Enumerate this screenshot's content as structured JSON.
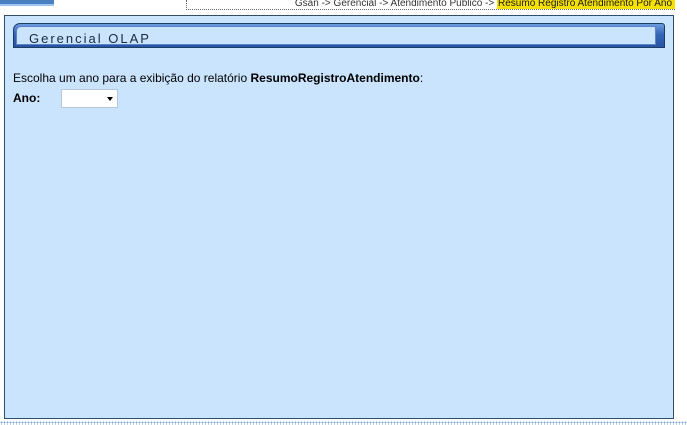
{
  "breadcrumb": {
    "items": [
      "Gsan",
      "Gerencial",
      "Atendimento Publico"
    ],
    "separator": " -> ",
    "current": "Resumo Registro Atendimento Por Ano"
  },
  "panel": {
    "title": "Gerencial OLAP"
  },
  "form": {
    "instruction_prefix": "Escolha um ano para a exibição do relatório ",
    "report_name": "ResumoRegistroAtendimento",
    "instruction_suffix": ":",
    "year_label": "Ano:",
    "year_value": ""
  },
  "colors": {
    "panel_background": "#cae4fd",
    "header_blue": "#3565b5",
    "breadcrumb_highlight": "#f5e100"
  }
}
